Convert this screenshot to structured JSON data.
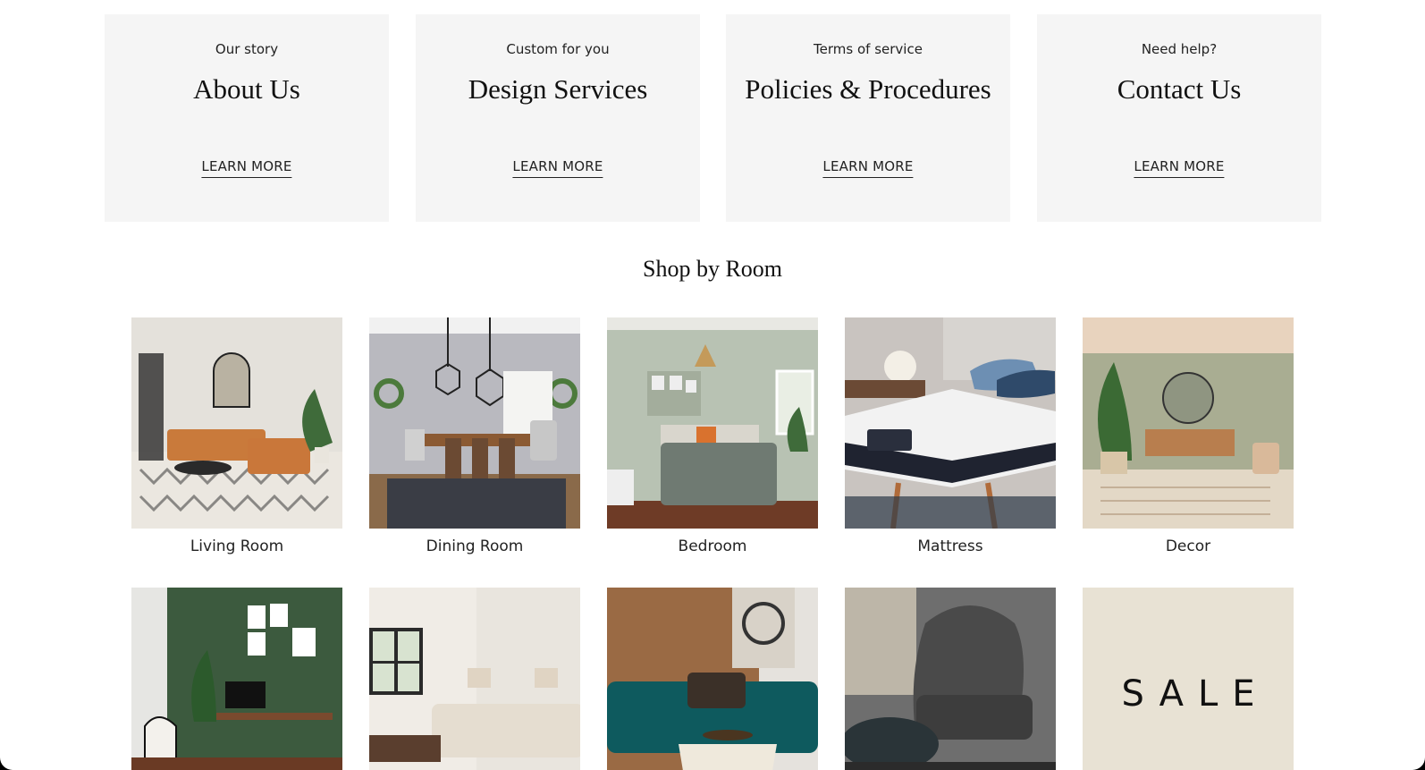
{
  "info_cards": [
    {
      "kicker": "Our story",
      "title": "About Us",
      "link": "LEARN MORE"
    },
    {
      "kicker": "Custom for you",
      "title": "Design Services",
      "link": "LEARN MORE"
    },
    {
      "kicker": "Terms of service",
      "title": "Policies & Procedures",
      "link": "LEARN MORE"
    },
    {
      "kicker": "Need help?",
      "title": "Contact Us",
      "link": "LEARN MORE"
    }
  ],
  "shop": {
    "title": "Shop by Room",
    "rooms": [
      {
        "label": "Living Room"
      },
      {
        "label": "Dining Room"
      },
      {
        "label": "Bedroom"
      },
      {
        "label": "Mattress"
      },
      {
        "label": "Decor"
      }
    ],
    "sale_label": "SALE"
  },
  "colors": {
    "card_bg": "#f5f5f5",
    "sale_bg": "#e8e2d4"
  }
}
